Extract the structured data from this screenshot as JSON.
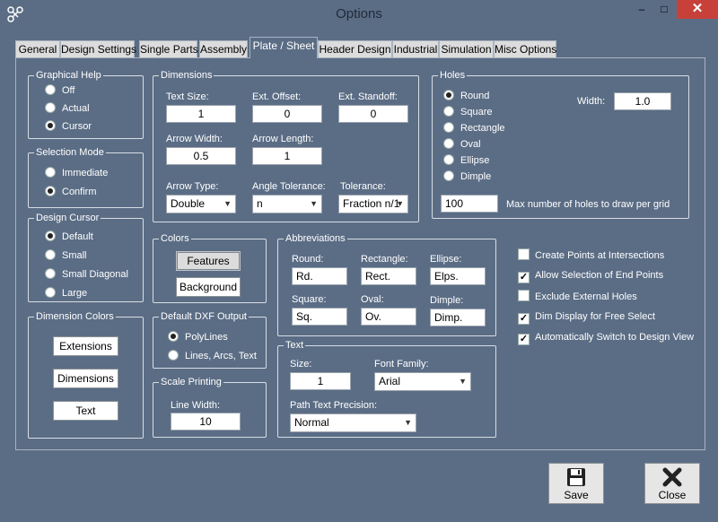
{
  "window": {
    "title": "Options",
    "minimize": "–",
    "maximize": "□",
    "close": "✕"
  },
  "tabs": [
    "General",
    "Design Settings",
    "Single Parts",
    "Assembly",
    "Plate / Sheet",
    "Header Design",
    "Industrial",
    "Simulation",
    "Misc Options"
  ],
  "graphical_help": {
    "title": "Graphical Help",
    "options": [
      "Off",
      "Actual",
      "Cursor"
    ],
    "selected": "Cursor"
  },
  "selection_mode": {
    "title": "Selection Mode",
    "options": [
      "Immediate",
      "Confirm"
    ],
    "selected": "Confirm"
  },
  "design_cursor": {
    "title": "Design Cursor",
    "options": [
      "Default",
      "Small",
      "Small Diagonal",
      "Large"
    ],
    "selected": "Default"
  },
  "dimension_colors": {
    "title": "Dimension Colors",
    "buttons": [
      "Extensions",
      "Dimensions",
      "Text"
    ]
  },
  "dimensions": {
    "title": "Dimensions",
    "text_size_label": "Text Size:",
    "text_size": "1",
    "ext_offset_label": "Ext. Offset:",
    "ext_offset": "0",
    "ext_standoff_label": "Ext. Standoff:",
    "ext_standoff": "0",
    "arrow_width_label": "Arrow Width:",
    "arrow_width": "0.5",
    "arrow_length_label": "Arrow Length:",
    "arrow_length": "1",
    "arrow_type_label": "Arrow Type:",
    "arrow_type": "Double",
    "angle_tolerance_label": "Angle Tolerance:",
    "angle_tolerance": "n",
    "tolerance_label": "Tolerance:",
    "tolerance": "Fraction n/1"
  },
  "colors": {
    "title": "Colors",
    "features": "Features",
    "background": "Background"
  },
  "dxf": {
    "title": "Default DXF Output",
    "options": [
      "PolyLines",
      "Lines, Arcs, Text"
    ],
    "selected": "PolyLines"
  },
  "scale_printing": {
    "title": "Scale Printing",
    "line_width_label": "Line Width:",
    "line_width": "10"
  },
  "abbreviations": {
    "title": "Abbreviations",
    "round_label": "Round:",
    "round": "Rd.",
    "rectangle_label": "Rectangle:",
    "rectangle": "Rect.",
    "ellipse_label": "Ellipse:",
    "ellipse": "Elps.",
    "square_label": "Square:",
    "square": "Sq.",
    "oval_label": "Oval:",
    "oval": "Ov.",
    "dimple_label": "Dimple:",
    "dimple": "Dimp."
  },
  "text": {
    "title": "Text",
    "size_label": "Size:",
    "size": "1",
    "font_family_label": "Font Family:",
    "font_family": "Arial",
    "path_precision_label": "Path Text Precision:",
    "path_precision": "Normal"
  },
  "holes": {
    "title": "Holes",
    "options": [
      "Round",
      "Square",
      "Rectangle",
      "Oval",
      "Ellipse",
      "Dimple"
    ],
    "selected": "Round",
    "width_label": "Width:",
    "width": "1.0",
    "max_holes": "100",
    "max_holes_label": "Max number of holes to draw per grid"
  },
  "checkboxes": [
    {
      "label": "Create Points at Intersections",
      "checked": false
    },
    {
      "label": "Allow Selection of End Points",
      "checked": true
    },
    {
      "label": "Exclude External Holes",
      "checked": false
    },
    {
      "label": "Dim Display for Free Select",
      "checked": true
    },
    {
      "label": "Automatically Switch to Design View",
      "checked": true
    }
  ],
  "footer": {
    "save": "Save",
    "close": "Close"
  }
}
